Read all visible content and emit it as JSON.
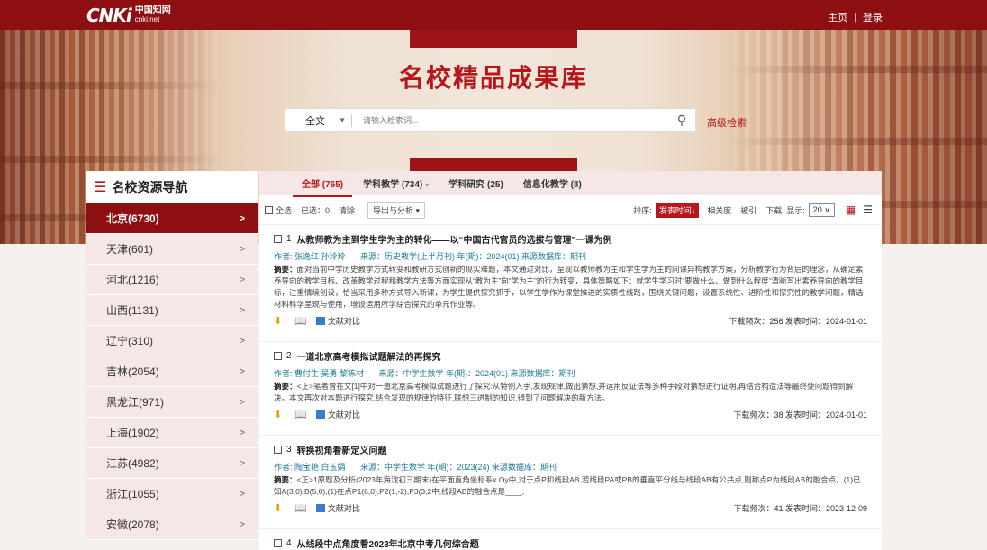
{
  "header": {
    "logo_text": "CNKi",
    "logo_cn": "中国知网",
    "logo_en": "cnki.net",
    "home_link": "主页",
    "login_link": "登录"
  },
  "hero": {
    "title": "名校精品成果库",
    "search_type": "全文",
    "search_placeholder": "请输入检索词...",
    "advanced_search": "高级检索"
  },
  "nav": {
    "title": "名校资源导航",
    "items": [
      {
        "label": "北京(6730)",
        "active": true
      },
      {
        "label": "天津(601)"
      },
      {
        "label": "河北(1216)"
      },
      {
        "label": "山西(1131)"
      },
      {
        "label": "辽宁(310)"
      },
      {
        "label": "吉林(2054)"
      },
      {
        "label": "黑龙江(971)"
      },
      {
        "label": "上海(1902)"
      },
      {
        "label": "江苏(4982)"
      },
      {
        "label": "浙江(1055)"
      },
      {
        "label": "安徽(2078)"
      }
    ]
  },
  "tabs": [
    {
      "label": "全部 (765)"
    },
    {
      "label": "学科教学 (734)"
    },
    {
      "label": "学科研究 (25)"
    },
    {
      "label": "信息化教学 (8)"
    }
  ],
  "toolbar": {
    "select_all": "全选",
    "selected": "已选：0",
    "clear": "清除",
    "export": "导出与分析 ▾",
    "sort_label": "排序:",
    "sort_active": "发表时间↓",
    "sort_relevance": "相关度",
    "sort_cited": "被引",
    "sort_download": "下载",
    "display_label": "显示:",
    "page_size": "20 ∨"
  },
  "results": [
    {
      "num": "1",
      "title": "从教师教为主到学生学为主的转化——以“中国古代官员的选拔与管理”一课为例",
      "authors": "作者:  张逸红  孙玲玲",
      "source": "来源：历史教学(上半月刊) 年(期)：2024(01) 来源数据库：期刊",
      "abstract_label": "摘要：",
      "abstract": "面对当前中学历史教学方式转变和教研方式创新的现实难题，本文通过对比，呈现以教师教为主和学生学为主的同课异构教学方案，分析教学行为背后的理念，从确定素养导向的教学目标、改革教学过程和教学方法等方面实现从“教为主”向“学为主”的行为转变，具体策略如下：就学生学习时“要做什么、做到什么程度”清晰写出素养导向的教学目标，注重情境创设，恰当采用多种方式导入新课，为学生提供探究抓手，以学生学作为课堂推进的实质性线路，围绕关键问题，设置系统性、进阶性和探究性的教学问题，精选材料科学呈现与使用，增设运用所学综合探究的单元作业等。",
      "compare": "文献对比",
      "stats": "下载频次：256 发表时间：2024-01-01"
    },
    {
      "num": "2",
      "title": "一道北京高考模拟试题解法的再探究",
      "authors": "作者:  曹付生  吴勇  黎栋材",
      "source": "来源：中学生数学 年(期)：2024(01) 来源数据库：期刊",
      "abstract_label": "摘要：",
      "abstract": "<正>笔者曾在文[1]中对一道北京高考模拟试题进行了探究:从特例入手,发现规律,做出猜想,并运用反证法等多种手段对猜想进行证明,再结合构造法等最终使问题得到解决。本文再次对本题进行探究,结合发现的规律的特征,联想三进制的知识,得到了问题解决的新方法。",
      "compare": "文献对比",
      "stats": "下载频次：38 发表时间：2024-01-01"
    },
    {
      "num": "3",
      "title": "转换视角看新定义问题",
      "authors": "作者:  陶宝艳  白玉娟",
      "source": "来源：中学生数学 年(期)：2023(24) 来源数据库：期刊",
      "abstract_label": "摘要：",
      "abstract": "<正>1原题及分析(2023年海淀初三期末)在平面直角坐标系x Oy中,对于点P和线段AB,若线段PA或PB的垂直平分线与线段AB有公共点,则称点P为线段AB的融合点。(1)已知A(3,0),B(5,0),(1)在点P1(6,0),P2(1,-2),P3(3,2中,线段AB的融合点是____;",
      "compare": "文献对比",
      "stats": "下载频次：41 发表时间：2023-12-09"
    },
    {
      "num": "4",
      "title": "从线段中点角度看2023年北京中考几何综合题",
      "authors": "",
      "source": "",
      "abstract_label": "",
      "abstract": "",
      "compare": "",
      "stats": ""
    }
  ]
}
